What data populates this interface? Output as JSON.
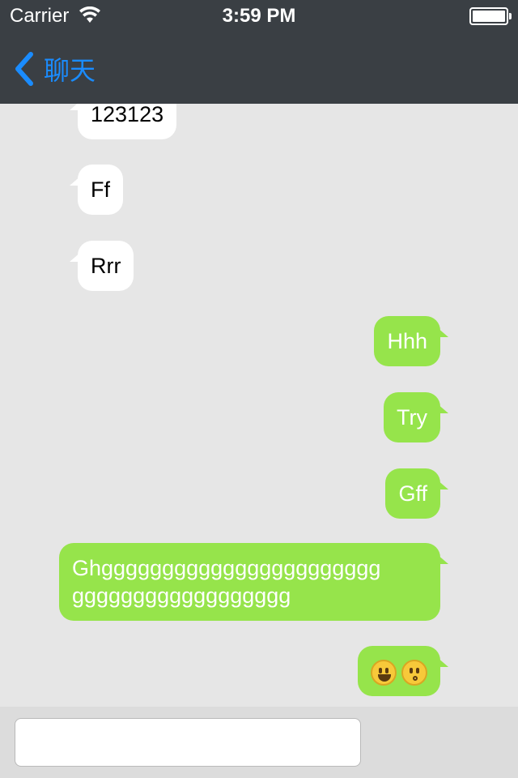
{
  "status_bar": {
    "carrier": "Carrier",
    "time": "3:59 PM",
    "wifi_icon": "wifi-icon",
    "battery_icon": "battery-icon"
  },
  "nav": {
    "back_label": "聊天",
    "back_icon": "chevron-left-icon"
  },
  "messages": [
    {
      "direction": "incoming",
      "text": "123123"
    },
    {
      "direction": "incoming",
      "text": "Ff"
    },
    {
      "direction": "incoming",
      "text": "Rrr"
    },
    {
      "direction": "outgoing",
      "text": "Hhh"
    },
    {
      "direction": "outgoing",
      "text": "Try"
    },
    {
      "direction": "outgoing",
      "text": "Gff"
    },
    {
      "direction": "outgoing",
      "text": "Ghgggggggggggggggggggggggggggggggggggggggg",
      "line1": "Ghggggggggggggggggggggggg",
      "line2": "gggggggggggggggggg"
    },
    {
      "direction": "outgoing",
      "emoji": [
        "smiley-face-emoji",
        "kissing-face-emoji"
      ]
    }
  ],
  "composer": {
    "value": "",
    "placeholder": ""
  },
  "colors": {
    "nav_background": "#3a3f44",
    "accent": "#1a8cff",
    "outgoing_bubble": "#96e44b",
    "incoming_bubble": "#ffffff",
    "chat_background": "#e6e6e6"
  }
}
